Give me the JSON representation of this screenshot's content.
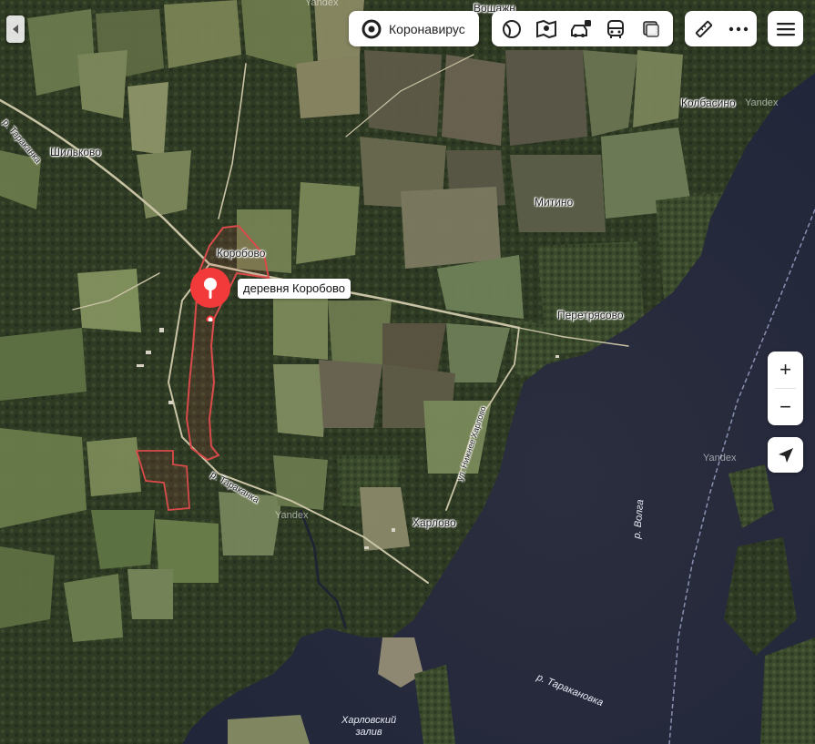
{
  "map": {
    "settlements": [
      {
        "id": "shilkovo",
        "name": "Шильково"
      },
      {
        "id": "korobovo",
        "name": "Коробово"
      },
      {
        "id": "mitino",
        "name": "Митино"
      },
      {
        "id": "kolbasino",
        "name": "Колбасино"
      },
      {
        "id": "peretryasovo",
        "name": "Перетрясово"
      },
      {
        "id": "kharlovo",
        "name": "Харлово"
      },
      {
        "id": "voshchazhnikovo-partial",
        "name": "Вощажн"
      }
    ],
    "roads": [
      {
        "id": "road-tarakanovka-nw",
        "name": "р. Тараканка"
      },
      {
        "id": "road-tarakanovka-center",
        "name": "р. Тараканка"
      },
      {
        "id": "street-nizhny-kharlovo",
        "name": "ул. Нижнее Харлово"
      }
    ],
    "water": [
      {
        "id": "volga",
        "name": "р. Волга"
      },
      {
        "id": "tarakanovka",
        "name": "р. Таракановка"
      },
      {
        "id": "kharlovsky-bay",
        "name": "Харловский\nзалив"
      }
    ],
    "watermark": "Yandex"
  },
  "search_result": {
    "label": "деревня Коробово",
    "pin_color": "#f33a3a",
    "boundary_color": "#d94a4a"
  },
  "toolbar": {
    "back_icon": "chevron-left-icon",
    "covid_label": "Коронавирус",
    "covid_icon": "target-circle-icon",
    "layers": [
      {
        "name": "satellite-layer-icon"
      },
      {
        "name": "panorama-icon"
      },
      {
        "name": "traffic-icon"
      },
      {
        "name": "transit-icon"
      },
      {
        "name": "map-type-icon"
      }
    ],
    "ruler_icon": "ruler-icon",
    "more_icon": "more-dots-icon",
    "menu_icon": "hamburger-menu-icon"
  },
  "controls": {
    "zoom_in": "+",
    "zoom_out": "−",
    "locate_icon": "locate-arrow-icon"
  },
  "colors": {
    "accent_red": "#f33a3a",
    "panel_bg": "#ffffff",
    "water": "#2b2f3f"
  }
}
